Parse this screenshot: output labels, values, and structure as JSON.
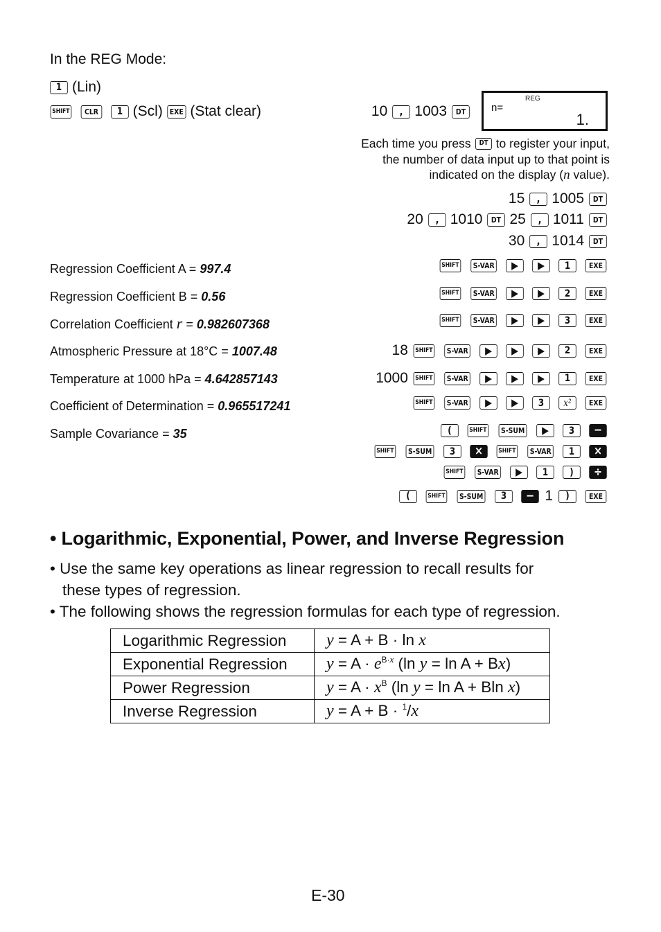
{
  "intro": {
    "mode_line": "In the REG Mode:",
    "lin_key": "1",
    "lin_label": "(Lin)",
    "clear_keys": [
      "SHIFT",
      "CLR",
      "1"
    ],
    "scl_label": "(Scl)",
    "exe_key": "EXE",
    "stat_clear_label": "(Stat clear)"
  },
  "first_entry": {
    "x": "10",
    "comma_key": ",",
    "y": "1003",
    "dt_key": "DT"
  },
  "display": {
    "mode_indicator": "REG",
    "label": "n=",
    "value": "1."
  },
  "note": {
    "line1_pre": "Each time you press",
    "line1_key": "DT",
    "line1_post": "to register your input,",
    "line2": "the number of data input up to that point is",
    "line3_pre": "indicated on the display (",
    "line3_var": "n",
    "line3_post": " value)."
  },
  "data_entries": [
    {
      "x": "15",
      "y": "1005"
    },
    {
      "x": "20",
      "y": "1010"
    },
    {
      "x": "25",
      "y": "1011"
    },
    {
      "x": "30",
      "y": "1014"
    }
  ],
  "results": [
    {
      "label": "Regression Coefficient A = ",
      "value": "997.4",
      "prefix": "",
      "keys": [
        "SHIFT",
        "S-VAR",
        "▶",
        "▶",
        "1",
        "EXE"
      ]
    },
    {
      "label": "Regression Coefficient B = ",
      "value": "0.56",
      "prefix": "",
      "keys": [
        "SHIFT",
        "S-VAR",
        "▶",
        "▶",
        "2",
        "EXE"
      ]
    },
    {
      "label_pre": "Correlation Coefficient ",
      "label_var": "r",
      "label_post": " = ",
      "value": "0.982607368",
      "prefix": "",
      "keys": [
        "SHIFT",
        "S-VAR",
        "▶",
        "▶",
        "3",
        "EXE"
      ]
    },
    {
      "label": "Atmospheric Pressure at 18°C = ",
      "value": "1007.48",
      "prefix": "18",
      "keys": [
        "SHIFT",
        "S-VAR",
        "▶",
        "▶",
        "▶",
        "2",
        "EXE"
      ]
    },
    {
      "label": "Temperature at 1000 hPa = ",
      "value": "4.642857143",
      "prefix": "1000",
      "keys": [
        "SHIFT",
        "S-VAR",
        "▶",
        "▶",
        "▶",
        "1",
        "EXE"
      ]
    },
    {
      "label": "Coefficient of Determination = ",
      "value": "0.965517241",
      "prefix": "",
      "keys": [
        "SHIFT",
        "S-VAR",
        "▶",
        "▶",
        "3",
        "x²",
        "EXE"
      ]
    },
    {
      "label": "Sample Covariance = ",
      "value": "35",
      "prefix": "",
      "keys": []
    }
  ],
  "covariance_keys": [
    [
      "(",
      "SHIFT",
      "S-SUM",
      "▶",
      "3",
      "−"
    ],
    [
      "SHIFT",
      "S-SUM",
      "3",
      "×",
      "SHIFT",
      "S-VAR",
      "1",
      "×"
    ],
    [
      "SHIFT",
      "S-VAR",
      "▶",
      "1",
      ")",
      "÷"
    ],
    [
      "(",
      "SHIFT",
      "S-SUM",
      "3",
      "−",
      "1",
      ")",
      "EXE"
    ]
  ],
  "section": {
    "title": "• Logarithmic, Exponential, Power, and Inverse Regression",
    "bullets": [
      "Use the same key operations as linear regression to recall results for",
      "these types of regression.",
      "The following shows the regression formulas for each type of regression."
    ]
  },
  "formula_table": {
    "rows": [
      {
        "name": "Logarithmic Regression",
        "formula": "y = A + B · ln x"
      },
      {
        "name": "Exponential Regression",
        "formula": "y = A · e^(B·x) (ln y = ln A + Bx)"
      },
      {
        "name": "Power Regression",
        "formula": "y = A · x^B (ln y = ln A + Bln x)"
      },
      {
        "name": "Inverse Regression",
        "formula": "y = A + B · 1/x"
      }
    ]
  },
  "footer": {
    "page_number": "E-30"
  }
}
